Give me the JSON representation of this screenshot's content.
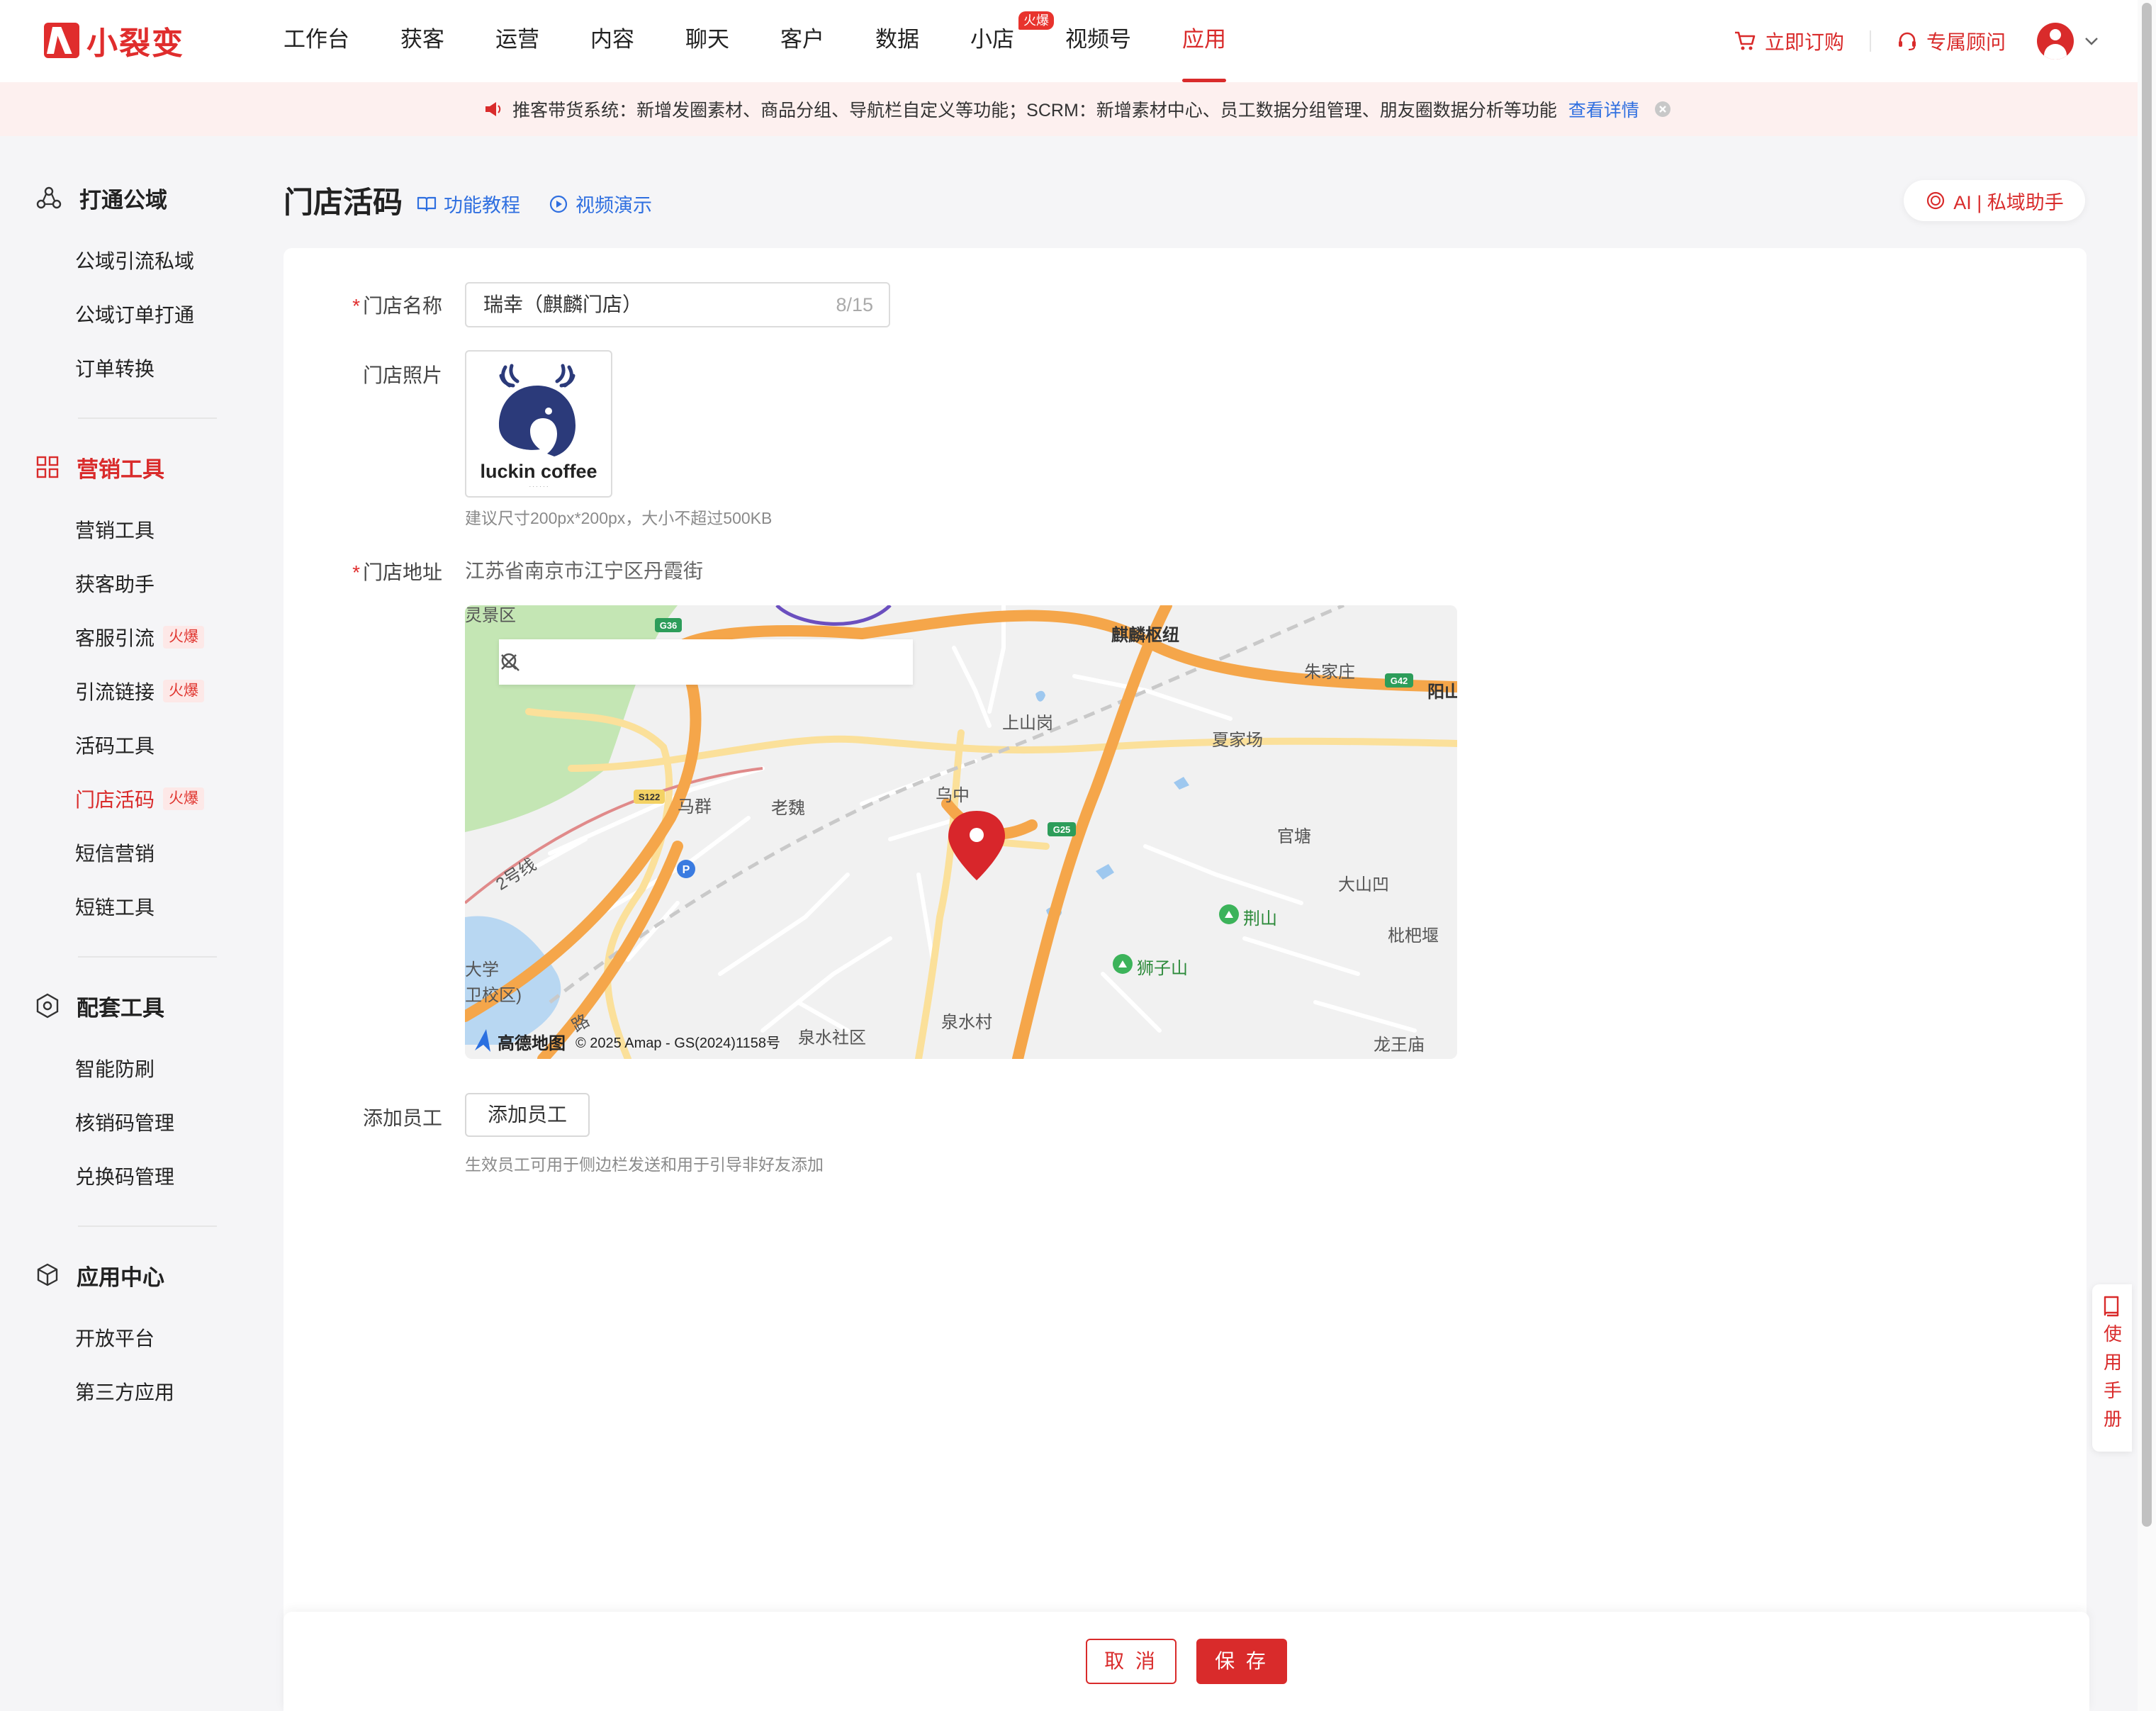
{
  "brand": {
    "name": "小裂变"
  },
  "nav": {
    "items": [
      {
        "label": "工作台"
      },
      {
        "label": "获客"
      },
      {
        "label": "运营"
      },
      {
        "label": "内容"
      },
      {
        "label": "聊天"
      },
      {
        "label": "客户"
      },
      {
        "label": "数据"
      },
      {
        "label": "小店",
        "badge": "火爆"
      },
      {
        "label": "视频号"
      },
      {
        "label": "应用",
        "active": true
      }
    ],
    "order_label": "立即订购",
    "advisor_label": "专属顾问"
  },
  "notice": {
    "text": "推客带货系统：新增发圈素材、商品分组、导航栏自定义等功能；SCRM：新增素材中心、员工数据分组管理、朋友圈数据分析等功能",
    "link": "查看详情"
  },
  "sidebar": {
    "groups": [
      {
        "title": "打通公域",
        "icon": "network-icon",
        "items": [
          {
            "label": "公域引流私域"
          },
          {
            "label": "公域订单打通"
          },
          {
            "label": "订单转换"
          }
        ]
      },
      {
        "title": "营销工具",
        "icon": "grid-icon",
        "active": true,
        "items": [
          {
            "label": "营销工具"
          },
          {
            "label": "获客助手"
          },
          {
            "label": "客服引流",
            "badge": "火爆"
          },
          {
            "label": "引流链接",
            "badge": "火爆"
          },
          {
            "label": "活码工具"
          },
          {
            "label": "门店活码",
            "badge": "火爆",
            "active": true
          },
          {
            "label": "短信营销"
          },
          {
            "label": "短链工具"
          }
        ]
      },
      {
        "title": "配套工具",
        "icon": "gear-hex-icon",
        "items": [
          {
            "label": "智能防刷"
          },
          {
            "label": "核销码管理"
          },
          {
            "label": "兑换码管理"
          }
        ]
      },
      {
        "title": "应用中心",
        "icon": "cube-icon",
        "items": [
          {
            "label": "开放平台"
          },
          {
            "label": "第三方应用"
          }
        ]
      }
    ]
  },
  "page": {
    "title": "门店活码",
    "tutorial_link": "功能教程",
    "video_link": "视频演示",
    "ai_button": "AI | 私域助手"
  },
  "form": {
    "store_name": {
      "label": "门店名称",
      "required": true,
      "value": "瑞幸（麒麟门店）",
      "counter": "8/15"
    },
    "store_photo": {
      "label": "门店照片",
      "image_text": "luckin coffee",
      "hint": "建议尺寸200px*200px，大小不超过500KB"
    },
    "store_address": {
      "label": "门店地址",
      "required": true,
      "value": "江苏省南京市江宁区丹霞街"
    },
    "add_staff": {
      "label": "添加员工",
      "button": "添加员工",
      "hint": "生效员工可用于侧边栏发送和用于引导非好友添加"
    }
  },
  "map": {
    "labels": {
      "qilin_hub": "麒麟枢纽",
      "zhujiazhuang": "朱家庄",
      "yang": "阳山",
      "shangshangang": "上山岗",
      "xiajiachang": "夏家场",
      "maqun": "马群",
      "laowei": "老魏",
      "wuzhong": "乌中",
      "guantang": "官塘",
      "dashanao": "大山凹",
      "jingshan": "荆山",
      "shizishan": "狮子山",
      "pipiyan": "枇杷堰",
      "daxue": "大学",
      "weixiaoqu": "卫校区)",
      "quanshuicun": "泉水村",
      "quanshuishequ": "泉水社区",
      "longwangmiao": "龙王庙",
      "lingjingqu": "灵景区",
      "road_g36": "G36",
      "road_s122": "S122",
      "road_g25": "G25",
      "road_g42": "G42",
      "line2": "2号线",
      "road_anonymous": "路"
    },
    "provider": "高德地图",
    "copyright": "© 2025 Amap - GS(2024)1158号"
  },
  "footer": {
    "cancel": "取 消",
    "save": "保 存"
  },
  "manual": {
    "label": "使用手册"
  },
  "colors": {
    "primary": "#d92b2b",
    "link": "#2f6fe0",
    "notice_bg": "#fdf0ef",
    "road_major": "#f5a64a",
    "road_minor": "#fbe3a4",
    "park": "#bfe3b0",
    "water": "#b5d4f0"
  }
}
